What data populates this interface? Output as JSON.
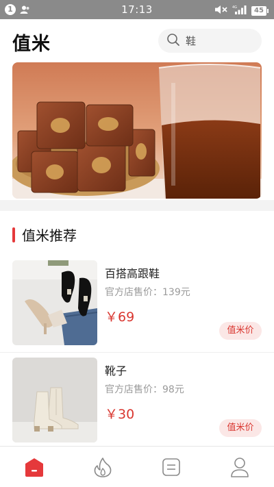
{
  "status_bar": {
    "notification_count": "1",
    "time": "17:13",
    "network": "4G",
    "battery": "45"
  },
  "header": {
    "app_title": "值米",
    "search_placeholder": "鞋"
  },
  "section": {
    "title": "值米推荐"
  },
  "products": [
    {
      "name": "百搭高跟鞋",
      "original_price": "官方店售价：139元",
      "price": "￥69",
      "badge": "值米价"
    },
    {
      "name": "靴子",
      "original_price": "官方店售价：98元",
      "price": "￥30",
      "badge": "值米价"
    }
  ],
  "tabbar": {
    "tabs": [
      {
        "icon": "home-icon",
        "active": true
      },
      {
        "icon": "flame-icon",
        "active": false
      },
      {
        "icon": "list-icon",
        "active": false
      },
      {
        "icon": "user-icon",
        "active": false
      }
    ]
  },
  "colors": {
    "accent": "#e5393b",
    "price": "#d9362f",
    "badge_bg": "#fbe7e6",
    "status_bar": "#8a8a8a"
  }
}
